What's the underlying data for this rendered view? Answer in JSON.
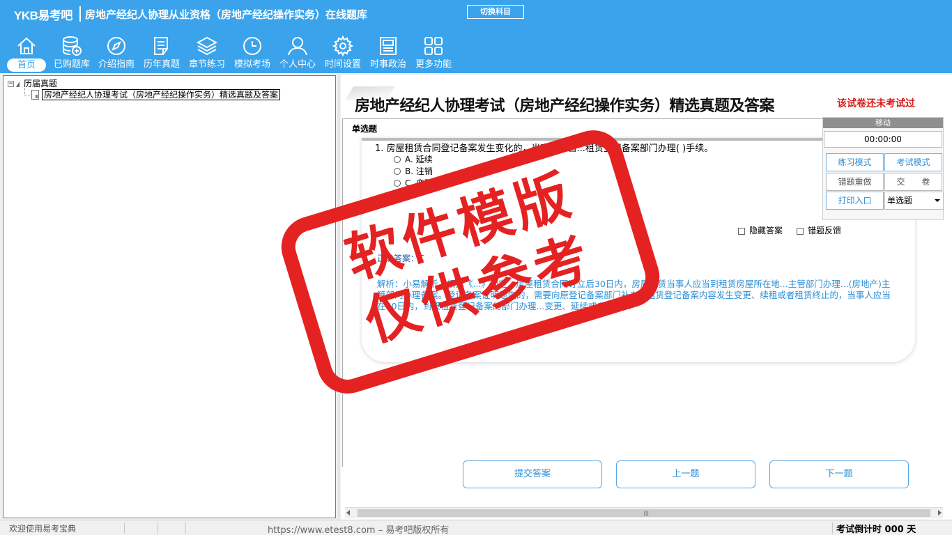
{
  "header": {
    "logo": "YKB易考吧",
    "title": "房地产经纪人协理从业资格（房地产经纪操作实务）在线题库",
    "switch_subject": "切换科目"
  },
  "nav": [
    {
      "label": "首页",
      "icon": "home-icon"
    },
    {
      "label": "已购题库",
      "icon": "database-icon"
    },
    {
      "label": "介绍指南",
      "icon": "compass-icon"
    },
    {
      "label": "历年真题",
      "icon": "document-list-icon"
    },
    {
      "label": "章节练习",
      "icon": "layers-icon"
    },
    {
      "label": "模拟考场",
      "icon": "clock-icon"
    },
    {
      "label": "个人中心",
      "icon": "user-icon"
    },
    {
      "label": "时间设置",
      "icon": "gear-icon"
    },
    {
      "label": "时事政治",
      "icon": "newspaper-icon"
    },
    {
      "label": "更多功能",
      "icon": "grid-icon"
    }
  ],
  "tree": {
    "root": "历届真题",
    "child": "房地产经纪人协理考试（房地产经纪操作实务）精选真题及答案"
  },
  "paper": {
    "title": "房地产经纪人协理考试（房地产经纪操作实务）精选真题及答案",
    "status": "该试卷还未考试过",
    "section": "单选题"
  },
  "question": {
    "stem": "1. 房屋租赁合同登记备案发生变化的，当事人应当...租赁登记备案部门办理( )手续。",
    "options": [
      "A. 延续",
      "B. 注销",
      "C. 变更"
    ],
    "hide_answer": "隐藏答案",
    "feedback": "错题反馈",
    "correct_answer": "正确答案：C",
    "analysis": "解析：小易解析，根据《...》规定，房屋租赁合同订立后30日内，房屋租赁当事人应当到租赁房屋所在地...主管部门办理...(房地产)主管部门办理备案。登记备案证明遗失的，需要向原登记备案部门补办...租赁登记备案内容发生变更、续租或者租赁终止的，当事人应当在30日内，到原租赁登记备案的部门办理...变更、延续或者注销..."
  },
  "timer": {
    "move": "移动",
    "time": "00:00:00",
    "practice_mode": "练习模式",
    "exam_mode": "考试模式",
    "redo_wrong": "错题重做",
    "submit": "交　　卷",
    "print": "打印入口",
    "question_type": "单选题"
  },
  "buttons": {
    "submit_answer": "提交答案",
    "prev": "上一题",
    "next": "下一题"
  },
  "status": {
    "welcome": "欢迎使用易考宝典",
    "url": "https://www.etest8.com – 易考吧版权所有",
    "countdown": "考试倒计时 000 天"
  },
  "watermark": {
    "line1": "软件模版",
    "line2": "仅供参考",
    "color": "#e52222"
  },
  "colors": {
    "header_bg": "#3aa3ec",
    "accent_text": "#2b8fd6",
    "alert": "#d41d1d"
  }
}
